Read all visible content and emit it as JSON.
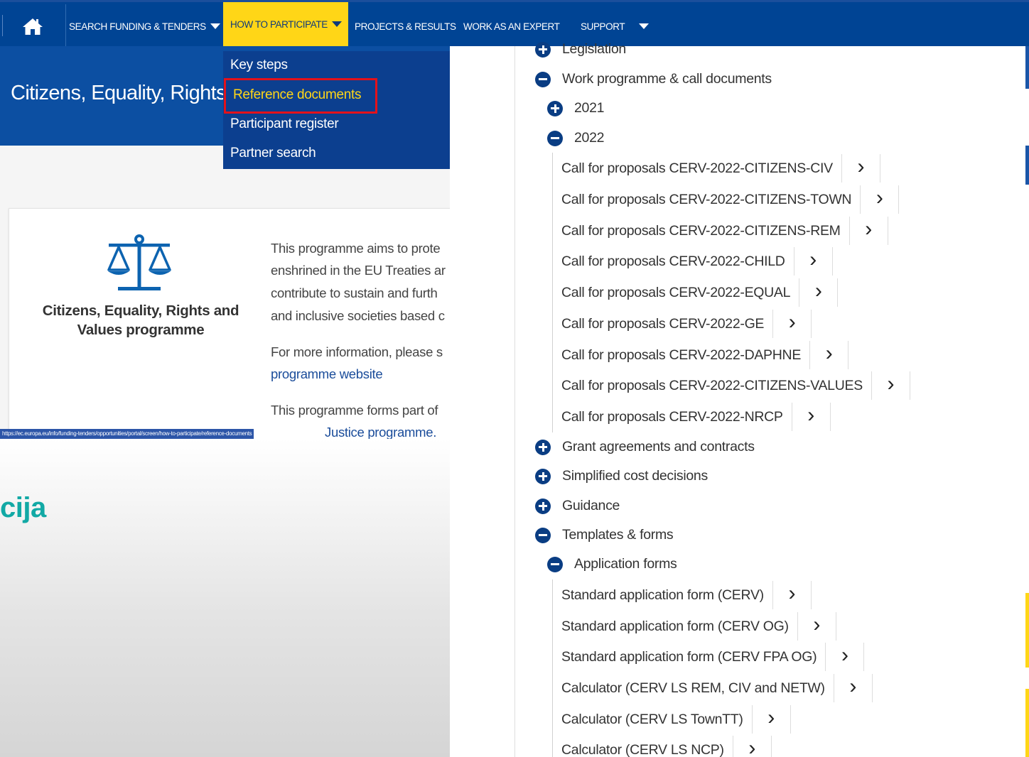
{
  "nav": {
    "items": [
      {
        "label": "SEARCH FUNDING & TENDERS"
      },
      {
        "label": "HOW TO PARTICIPATE"
      },
      {
        "label": "PROJECTS & RESULTS"
      },
      {
        "label": "WORK AS AN EXPERT"
      },
      {
        "label": "SUPPORT"
      }
    ]
  },
  "dropdown": {
    "items": [
      {
        "label": "Key steps"
      },
      {
        "label": "Reference documents"
      },
      {
        "label": "Participant register"
      },
      {
        "label": "Partner search"
      }
    ]
  },
  "banner": {
    "title": "Citizens, Equality, Rights"
  },
  "card": {
    "programme_name": "Citizens, Equality, Rights and Values programme",
    "desc_lines": [
      "This programme aims to prote",
      "enshrined in the EU Treaties ar",
      "contribute to sustain and furth",
      "and inclusive societies based c"
    ],
    "more_info": "For more information, please s",
    "link": "programme website",
    "part_of": "This programme forms part of",
    "part_of_link": "Justice programme."
  },
  "status_url": "https://ec.europa.eu/info/funding-tenders/opportunities/portal/screen/how-to-participate/reference-documents",
  "background_text": "cija",
  "tree": {
    "legislation": "Legislation",
    "work_programme": "Work programme & call documents",
    "year_2021": "2021",
    "year_2022": "2022",
    "calls": [
      "Call for proposals CERV-2022-CITIZENS-CIV",
      "Call for proposals CERV-2022-CITIZENS-TOWN",
      "Call for proposals CERV-2022-CITIZENS-REM",
      "Call for proposals CERV-2022-CHILD",
      "Call for proposals CERV-2022-EQUAL",
      "Call for proposals CERV-2022-GE",
      "Call for proposals CERV-2022-DAPHNE",
      "Call for proposals CERV-2022-CITIZENS-VALUES",
      "Call for proposals CERV-2022-NRCP"
    ],
    "grant_agreements": "Grant agreements and contracts",
    "simplified_cost": "Simplified cost decisions",
    "guidance": "Guidance",
    "templates": "Templates & forms",
    "application_forms": "Application forms",
    "forms": [
      "Standard application form (CERV)",
      "Standard application form (CERV OG)",
      "Standard application form (CERV FPA OG)",
      "Calculator (CERV LS REM, CIV and NETW)",
      "Calculator (CERV LS TownTT)",
      "Calculator (CERV LS NCP)"
    ]
  },
  "colors": {
    "nav_bg": "#004494",
    "active_yellow": "#ffd617",
    "highlight_red": "#e3121b",
    "icon_blue": "#0a3d83",
    "teal_text": "#12a9a5"
  }
}
